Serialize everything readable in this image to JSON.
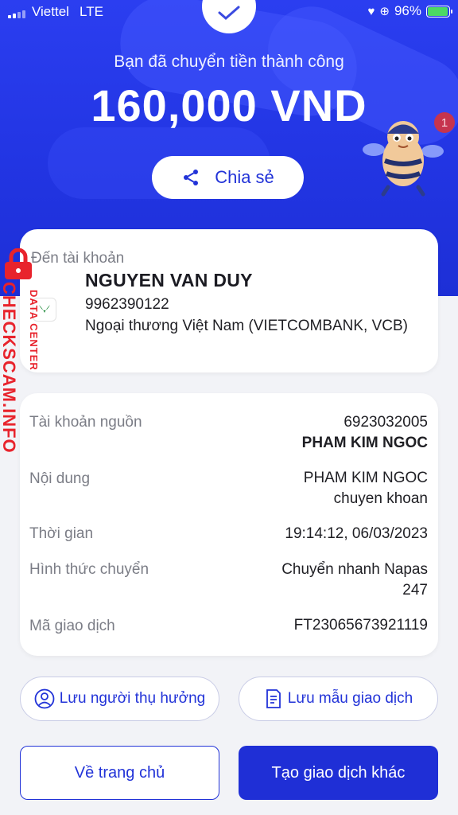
{
  "status_bar": {
    "carrier": "Viettel",
    "network": "LTE",
    "battery": "96%",
    "battery_level": 0.96
  },
  "header": {
    "success_message": "Bạn đã chuyển tiền thành công",
    "amount": "160,000 VND",
    "share_label": "Chia sẻ",
    "notification_count": "1"
  },
  "destination": {
    "label": "Đến tài khoản",
    "name": "NGUYEN VAN DUY",
    "account": "9962390122",
    "bank": "Ngoại thương Việt Nam (VIETCOMBANK, VCB)"
  },
  "details": {
    "source_label": "Tài khoản nguồn",
    "source_account": "6923032005",
    "source_name": "PHAM KIM NGOC",
    "content_label": "Nội dung",
    "content_line1": "PHAM KIM NGOC",
    "content_line2": "chuyen khoan",
    "time_label": "Thời gian",
    "time_value": "19:14:12, 06/03/2023",
    "method_label": "Hình thức chuyển",
    "method_line1": "Chuyển nhanh Napas",
    "method_line2": "247",
    "txn_label": "Mã giao dịch",
    "txn_value": "FT23065673921119"
  },
  "actions": {
    "save_beneficiary": "Lưu người thụ hưởng",
    "save_template": "Lưu mẫu giao dịch",
    "home": "Về trang chủ",
    "new_transaction": "Tạo giao dịch khác"
  },
  "watermark": {
    "main": "CHECKSCAM.INFO",
    "sub": "DATA CENTER"
  },
  "colors": {
    "brand_blue": "#2233d8",
    "hero_blue": "#2b3ef0",
    "watermark_red": "#e8232c"
  }
}
